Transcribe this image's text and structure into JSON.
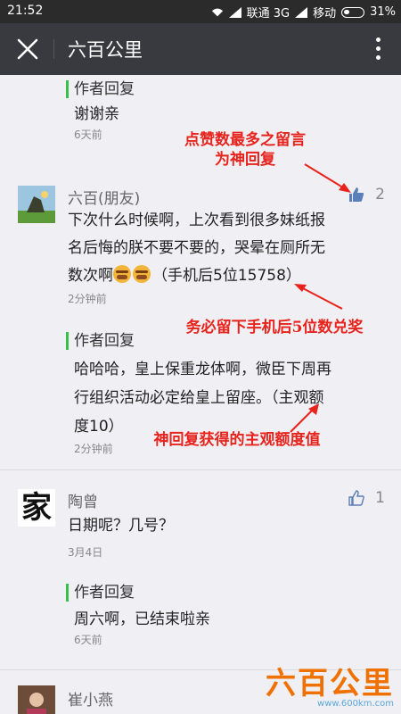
{
  "status": {
    "time": "21:52",
    "carrier1": "联通 3G",
    "carrier2": "移动",
    "battery": "31%"
  },
  "header": {
    "title": "六百公里"
  },
  "reply_tag": "作者回复",
  "items": {
    "reply0": {
      "text": "谢谢亲",
      "time": "6天前"
    },
    "comment1": {
      "name": "六百(朋友)",
      "likes": "2",
      "text_line1": "下次什么时候啊，上次看到很多妹纸报",
      "text_line2": "名后悔的朕不要不要的，哭晕在厕所无",
      "text_line3": "数次啊",
      "text_tail": "（手机后5位15758）",
      "time": "2分钟前"
    },
    "reply1": {
      "line1": "哈哈哈，皇上保重龙体啊，微臣下周再",
      "line2": "行组织活动必定给皇上留座。（主观额",
      "line3": "度10）",
      "time": "2分钟前"
    },
    "comment2": {
      "name": "陶曾",
      "likes": "1",
      "text": "日期呢？几号？",
      "time": "3月4日",
      "avatar_char": "家"
    },
    "reply2": {
      "text": "周六啊，已结束啦亲",
      "time": "6天前"
    },
    "comment3": {
      "name": "崔小燕"
    }
  },
  "annotations": {
    "a1_line1": "点赞数最多之留言",
    "a1_line2": "为神回复",
    "a2": "务必留下手机后5位数兑奖",
    "a3": "神回复获得的主观额度值"
  },
  "watermark": {
    "main": "六百公里",
    "url": "www.600km.com"
  },
  "colors": {
    "titlebar": "#393a3f",
    "reply_accent": "#35c147",
    "annotation": "#e8231c",
    "like_icon": "#5b7fb8"
  }
}
